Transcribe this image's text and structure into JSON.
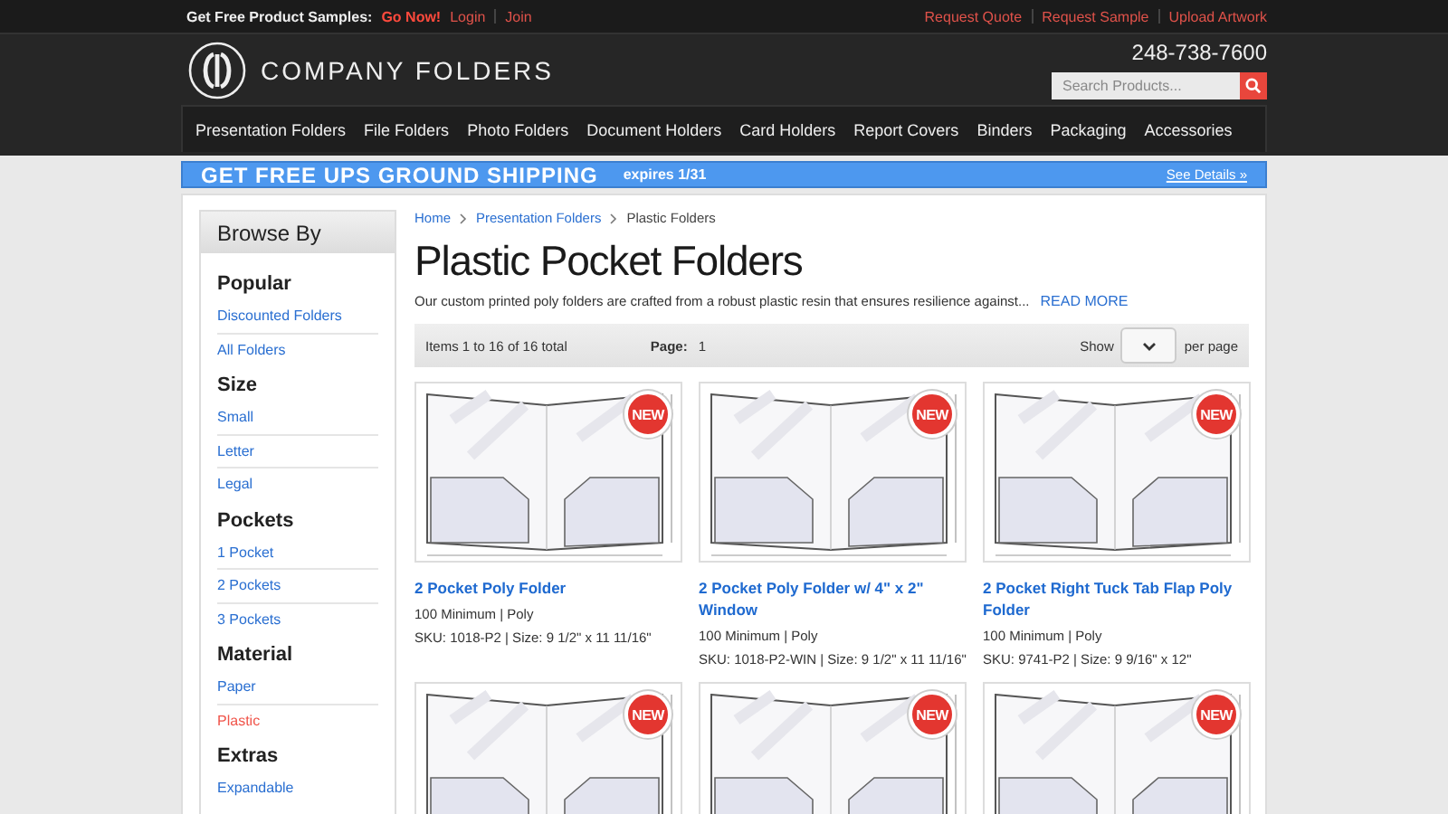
{
  "top_bar": {
    "promo": "Get Free Product Samples:",
    "promo_link": "Go Now!",
    "account_links": [
      "Login",
      "Join"
    ],
    "right_links": [
      "Request Quote",
      "Request Sample",
      "Upload Artwork"
    ]
  },
  "header": {
    "logo_text": "COMPANY FOLDERS",
    "phone": "248-738-7600",
    "search": {
      "placeholder": "Search Products..."
    }
  },
  "nav": [
    "Presentation Folders",
    "File Folders",
    "Photo Folders",
    "Document Holders",
    "Card Holders",
    "Report Covers",
    "Binders",
    "Packaging",
    "Accessories"
  ],
  "banner": {
    "headline": "GET FREE UPS GROUND SHIPPING",
    "expires": "expires 1/31",
    "link": "See Details »"
  },
  "sidebar": {
    "title": "Browse By",
    "groups": [
      {
        "heading": "Popular",
        "items": [
          {
            "label": "Discounted Folders",
            "selected": false
          },
          {
            "label": "All Folders",
            "selected": false
          }
        ]
      },
      {
        "heading": "Size",
        "items": [
          {
            "label": "Small",
            "selected": false
          },
          {
            "label": "Letter",
            "selected": false
          },
          {
            "label": "Legal",
            "selected": false
          }
        ]
      },
      {
        "heading": "Pockets",
        "items": [
          {
            "label": "1 Pocket",
            "selected": false
          },
          {
            "label": "2 Pockets",
            "selected": false
          },
          {
            "label": "3 Pockets",
            "selected": false
          }
        ]
      },
      {
        "heading": "Material",
        "items": [
          {
            "label": "Paper",
            "selected": false
          },
          {
            "label": "Plastic",
            "selected": true
          }
        ]
      },
      {
        "heading": "Extras",
        "items": [
          {
            "label": "Expandable",
            "selected": false
          }
        ]
      }
    ]
  },
  "breadcrumb": [
    "Home",
    "Presentation Folders",
    "Plastic Folders"
  ],
  "page_title": "Plastic Pocket Folders",
  "intro": {
    "text": "Our custom printed poly folders are crafted from a robust plastic resin that ensures resilience against...",
    "link": "READ MORE"
  },
  "toolbar": {
    "items_count": "Items 1 to 16 of 16 total",
    "page_label": "Page:",
    "page": "1",
    "show_label": "Show",
    "per_page_label": "per page"
  },
  "products": [
    {
      "badge": "NEW",
      "name": "2 Pocket Poly Folder",
      "details": "100 Minimum | Poly",
      "sku": "SKU: 1018-P2 | Size: 9 1/2\" x 11 11/16\""
    },
    {
      "badge": "NEW",
      "name": "2 Pocket Poly Folder w/ 4\" x 2\" Window",
      "details": "100 Minimum | Poly",
      "sku": "SKU: 1018-P2-WIN | Size: 9 1/2\" x 11 11/16\""
    },
    {
      "badge": "NEW",
      "name": "2 Pocket Right Tuck Tab Flap Poly Folder",
      "details": "100 Minimum | Poly",
      "sku": "SKU: 9741-P2 | Size: 9 9/16\" x 12\""
    },
    {
      "badge": "NEW"
    },
    {
      "badge": "NEW"
    },
    {
      "badge": "NEW"
    }
  ]
}
